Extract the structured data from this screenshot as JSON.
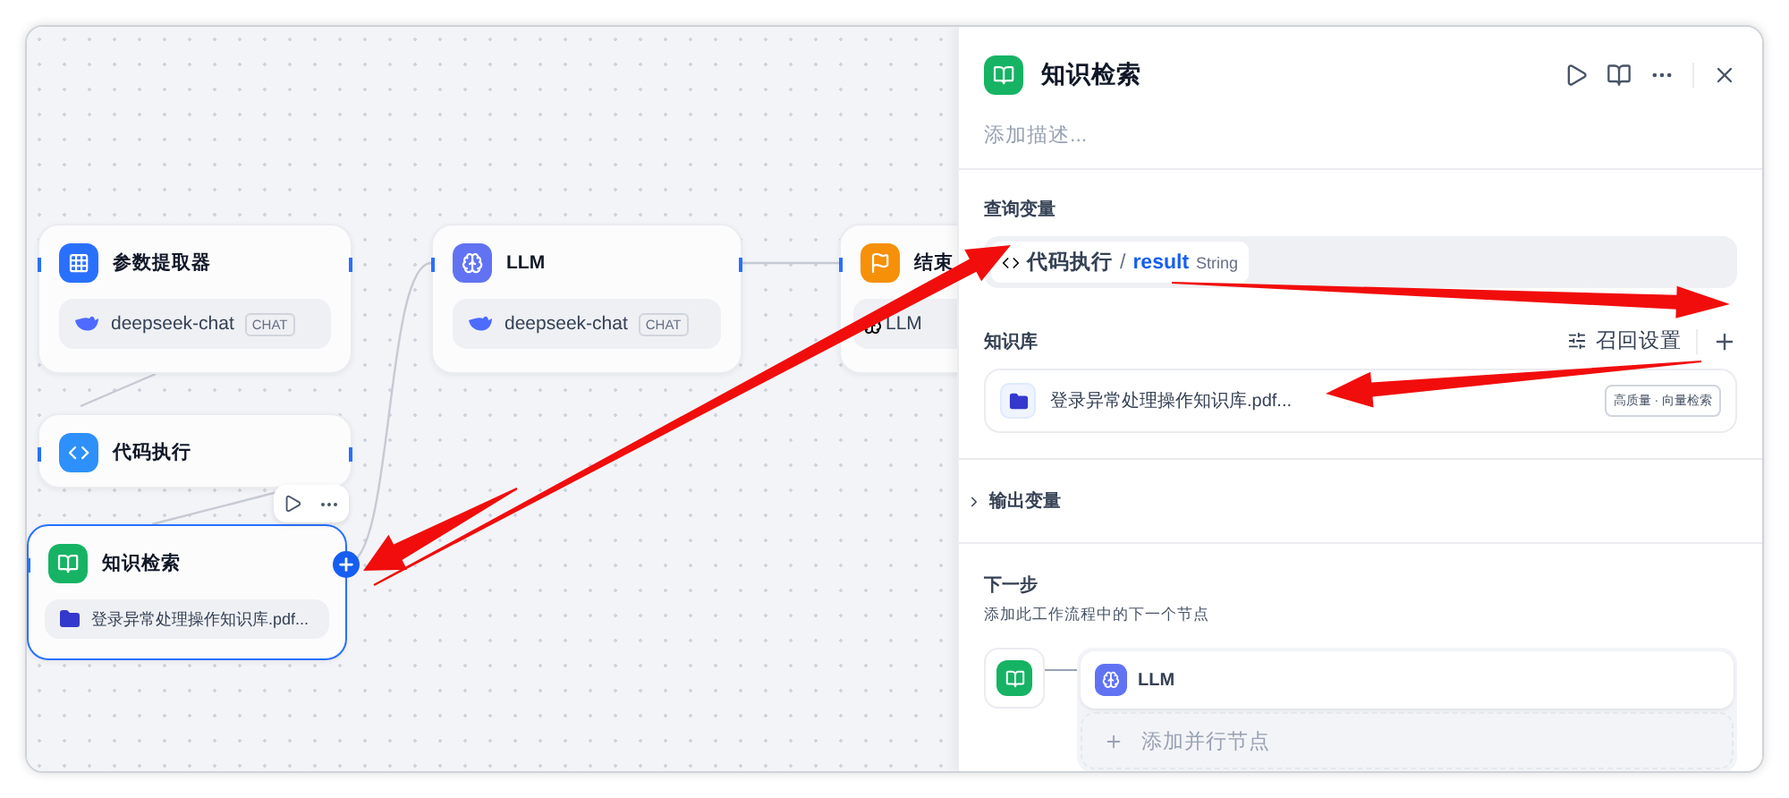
{
  "canvas": {
    "nodes": [
      {
        "kind": "parameter-extractor",
        "title": "参数提取器",
        "model": {
          "name": "deepseek-chat",
          "badge": "CHAT"
        },
        "selected": false
      },
      {
        "kind": "llm",
        "title": "LLM",
        "model": {
          "name": "deepseek-chat",
          "badge": "CHAT"
        },
        "selected": false
      },
      {
        "kind": "end",
        "title": "结束",
        "output_chip": "LLM",
        "selected": false
      },
      {
        "kind": "code",
        "title": "代码执行",
        "selected": false
      },
      {
        "kind": "knowledge",
        "title": "知识检索",
        "dataset": "登录异常处理操作知识库.pdf...",
        "selected": true
      }
    ]
  },
  "panel": {
    "title": "知识检索",
    "description": {
      "placeholder": "添加描述..."
    },
    "query_variable": {
      "label": "查询变量",
      "node": "代码执行",
      "separator": "/",
      "variable": "result",
      "type": "String"
    },
    "knowledge": {
      "label": "知识库",
      "recall_settings": "召回设置",
      "datasets": [
        {
          "name": "登录异常处理操作知识库.pdf...",
          "tag": "高质量 · 向量检索"
        }
      ]
    },
    "output_variables": {
      "label": "输出变量",
      "expanded": false
    },
    "next_step": {
      "title": "下一步",
      "description": "添加此工作流程中的下一个节点",
      "nodes": [
        {
          "kind": "llm",
          "title": "LLM"
        }
      ],
      "add_parallel": "添加并行节点"
    }
  }
}
